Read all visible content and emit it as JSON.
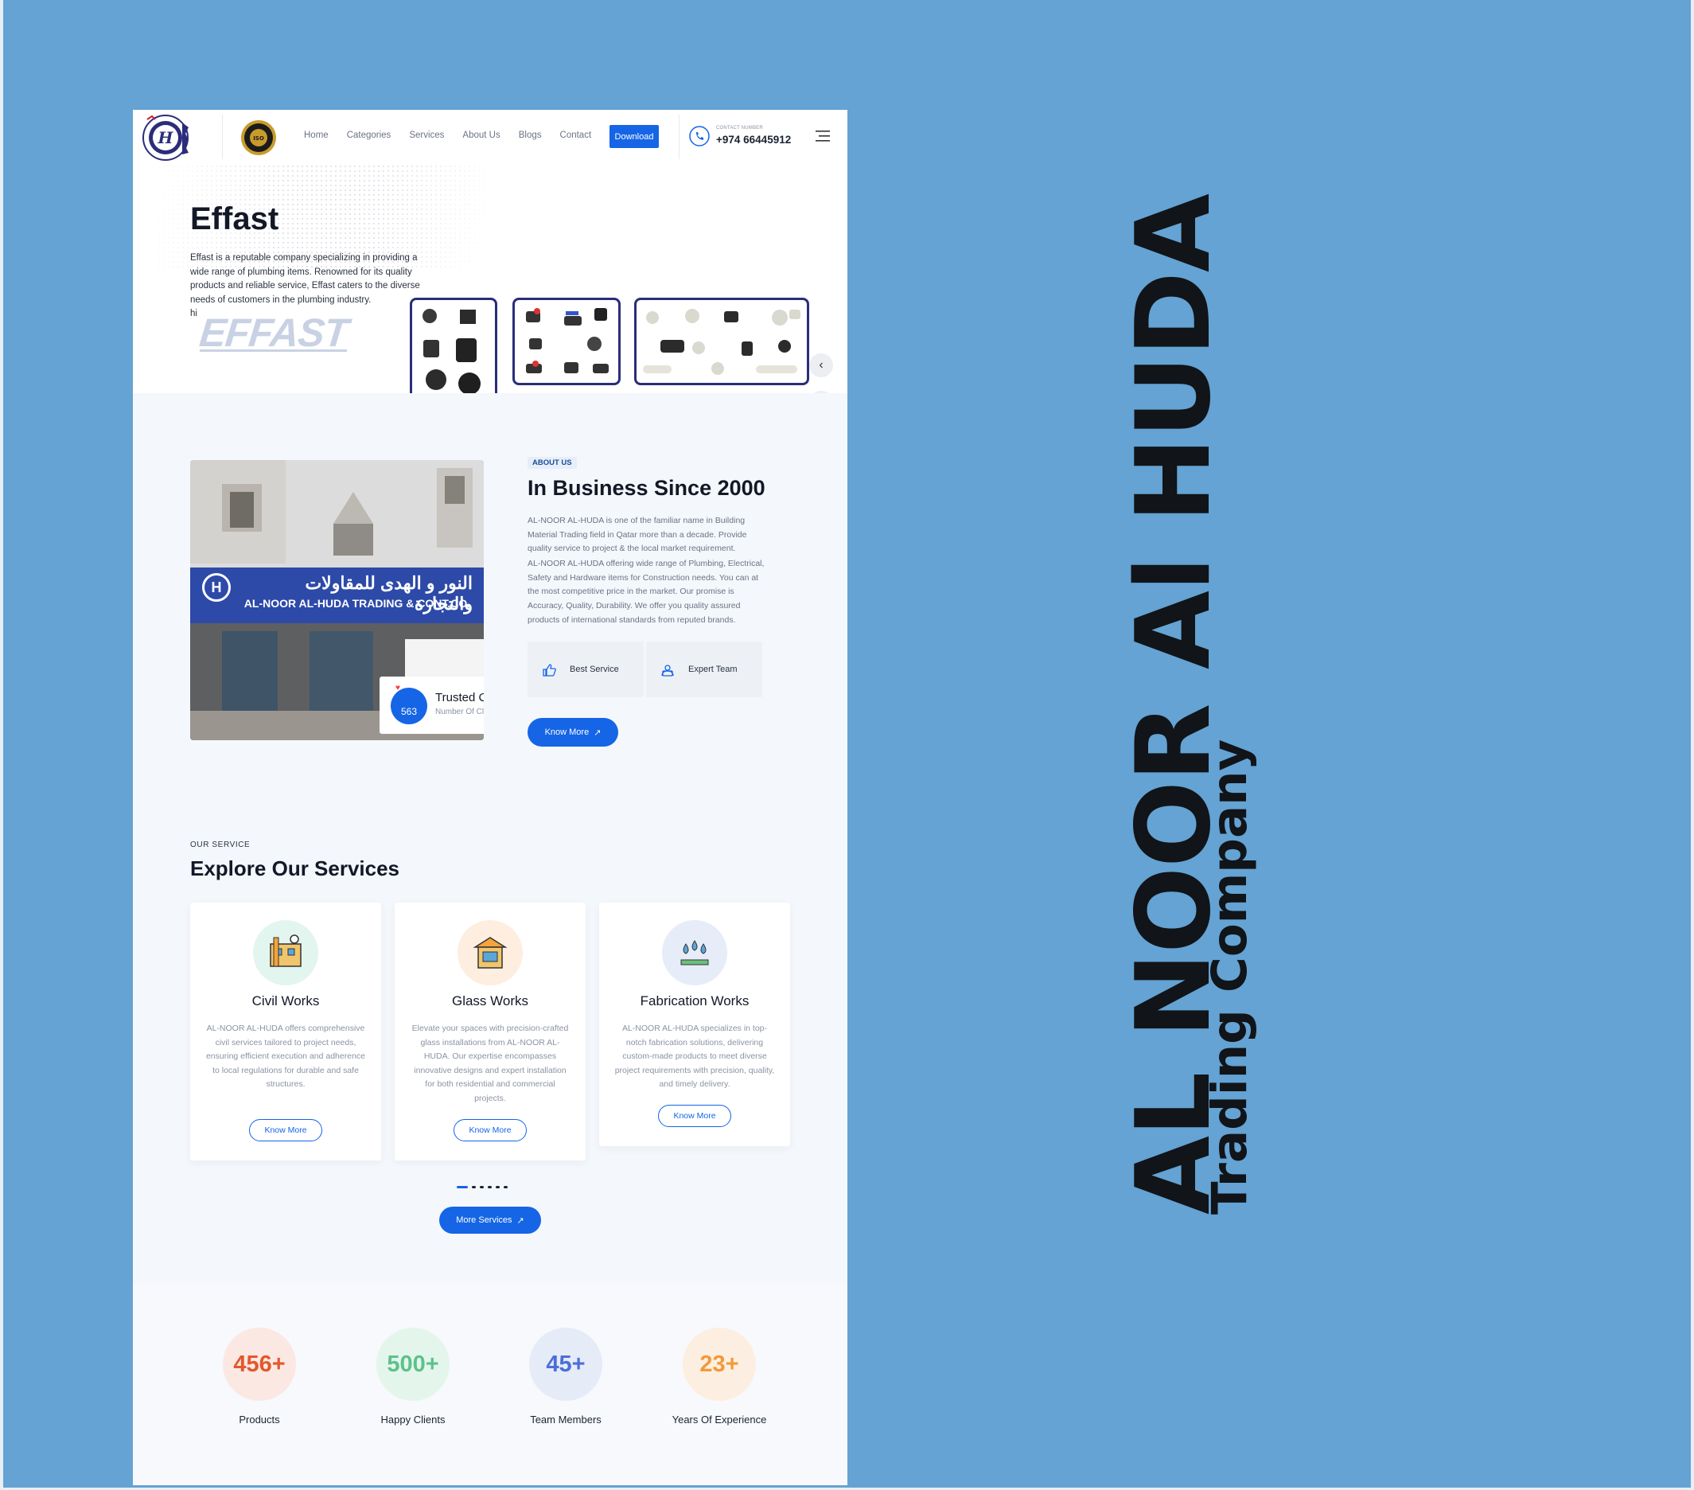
{
  "nav": {
    "links": [
      "Home",
      "Categories",
      "Services",
      "About Us",
      "Blogs",
      "Contact"
    ],
    "download_label": "Download",
    "contact_caption": "CONTACT NUMBER",
    "contact_number": "+974 66445912"
  },
  "hero": {
    "title": "Effast",
    "description": "Effast is a reputable company specializing in providing a wide range of plumbing items. Renowned for its quality products and reliable service, Effast caters to the diverse needs of customers in the plumbing industry.",
    "truncated_tail": "hi",
    "brand_logo_text": "EFFAST",
    "prev_label": "‹",
    "next_label": "›"
  },
  "about": {
    "storefront_sign_ar": "النور و الهدى للمقاولات والتجارة",
    "storefront_sign_en": "AL-NOOR AL-HUDA TRADING & CONT.CO.",
    "trusted_count": "563",
    "trusted_title": "Trusted Clients",
    "trusted_subtitle": "Number Of Clients",
    "eyebrow": "ABOUT US",
    "title": "In Business Since 2000",
    "para1": "AL-NOOR AL-HUDA is one of the familiar name in Building Material Trading field in Qatar more than a decade. Provide quality service to project & the local market requirement.",
    "para2": "AL-NOOR AL-HUDA offering wide range of Plumbing, Electrical, Safety and Hardware items for Construction needs. You can at the most competitive price in the market. Our promise is Accuracy, Quality, Durability. We offer you quality assured products of international standards from reputed brands.",
    "features": [
      "Best Service",
      "Expert Team"
    ],
    "cta": "Know More"
  },
  "services": {
    "eyebrow": "OUR SERVICE",
    "title": "Explore Our Services",
    "cards": [
      {
        "name": "Civil Works",
        "desc": "AL-NOOR AL-HUDA offers comprehensive civil services tailored to project needs, ensuring efficient execution and adherence to local regulations for durable and safe structures.",
        "button": "Know More",
        "tint": "#e3f5ef"
      },
      {
        "name": "Glass Works",
        "desc": "Elevate your spaces with precision-crafted glass installations from AL-NOOR AL-HUDA. Our expertise encompasses innovative designs and expert installation for both residential and commercial projects.",
        "button": "Know More",
        "tint": "#fdeee0"
      },
      {
        "name": "Fabrication Works",
        "desc": "AL-NOOR AL-HUDA specializes in top-notch fabrication solutions, delivering custom-made products to meet diverse project requirements with precision, quality, and timely delivery.",
        "button": "Know More",
        "tint": "#e7ecf9"
      }
    ],
    "more_button": "More Services"
  },
  "stats": [
    {
      "value": "456+",
      "label": "Products",
      "color": "#e2582c",
      "bg": "#fbe8e3"
    },
    {
      "value": "500+",
      "label": "Happy Clients",
      "color": "#5cc28a",
      "bg": "#e4f6ec"
    },
    {
      "value": "45+",
      "label": "Team Members",
      "color": "#4b6fd8",
      "bg": "#e6ebf8"
    },
    {
      "value": "23+",
      "label": "Years Of Experience",
      "color": "#f29a38",
      "bg": "#fcefe1"
    }
  ],
  "side": {
    "title": "AL NOOR Al HUDA",
    "subtitle": "Trading Company"
  },
  "colors": {
    "background": "#64A3D3",
    "primary": "#1565e6",
    "tile_border": "#2b2d7a"
  }
}
